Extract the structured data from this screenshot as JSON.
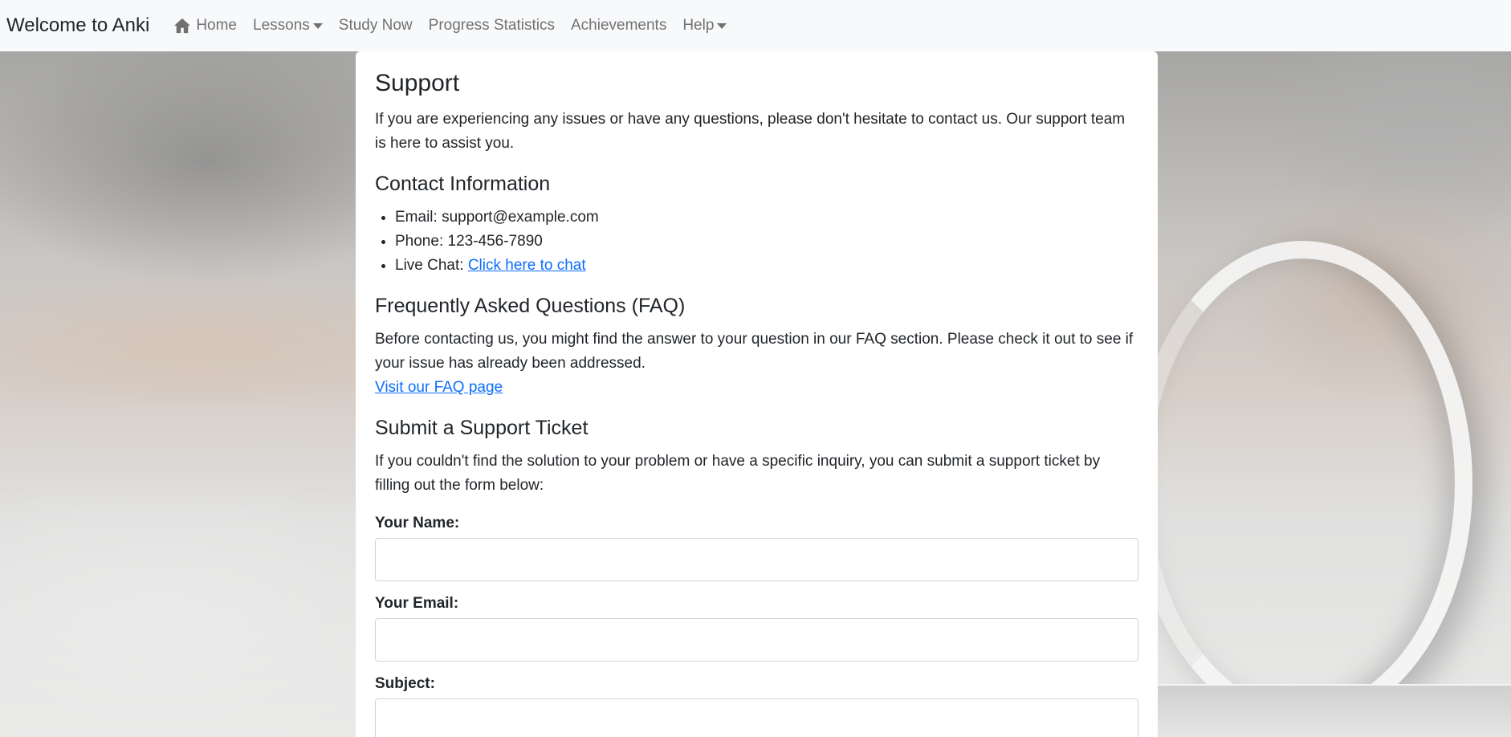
{
  "navbar": {
    "brand": "Welcome to Anki",
    "items": [
      {
        "label": "Home",
        "icon": "home-icon"
      },
      {
        "label": "Lessons",
        "dropdown": true
      },
      {
        "label": "Study Now"
      },
      {
        "label": "Progress Statistics"
      },
      {
        "label": "Achievements"
      },
      {
        "label": "Help",
        "dropdown": true
      }
    ]
  },
  "support": {
    "title": "Support",
    "intro": "If you are experiencing any issues or have any questions, please don't hesitate to contact us. Our support team is here to assist you."
  },
  "contact": {
    "heading": "Contact Information",
    "email_label": "Email: support@example.com",
    "phone_label": "Phone: 123-456-7890",
    "chat_prefix": "Live Chat: ",
    "chat_link": "Click here to chat"
  },
  "faq": {
    "heading": "Frequently Asked Questions (FAQ)",
    "text": "Before contacting us, you might find the answer to your question in our FAQ section. Please check it out to see if your issue has already been addressed.",
    "link": "Visit our FAQ page"
  },
  "ticket": {
    "heading": "Submit a Support Ticket",
    "text": "If you couldn't find the solution to your problem or have a specific inquiry, you can submit a support ticket by filling out the form below:",
    "name_label": "Your Name:",
    "name_value": "",
    "email_label": "Your Email:",
    "email_value": "",
    "subject_label": "Subject:",
    "subject_value": ""
  },
  "colors": {
    "link": "#0d6efd",
    "navbar_bg": "#f8f9fa",
    "card_bg": "#ffffff"
  }
}
